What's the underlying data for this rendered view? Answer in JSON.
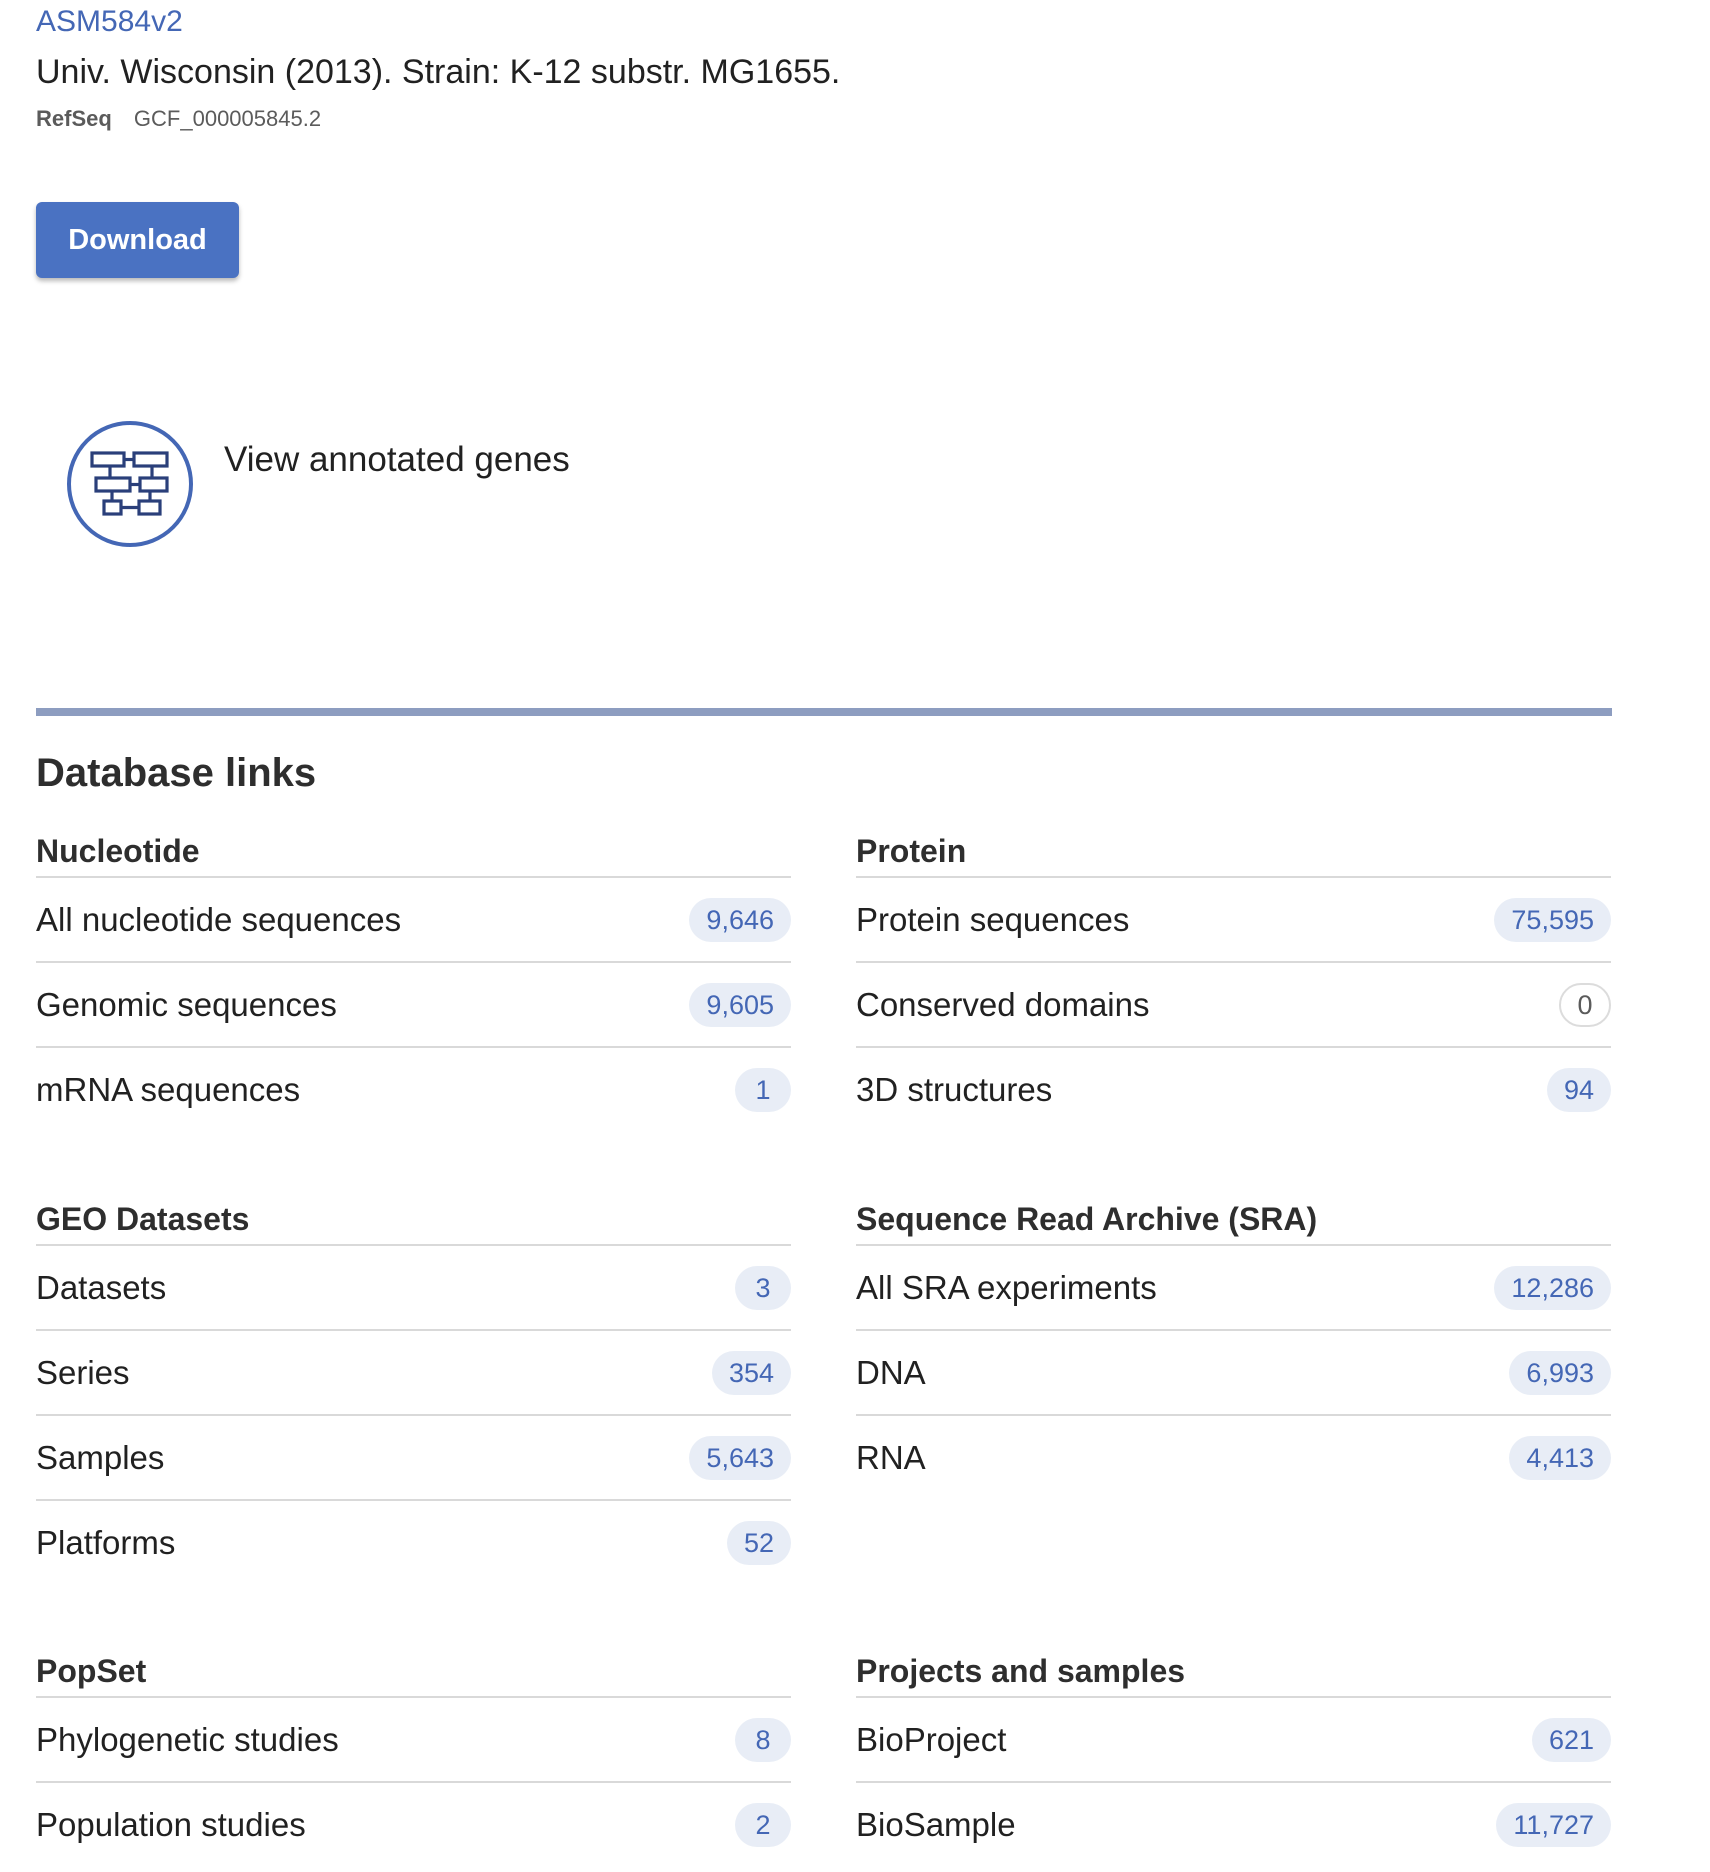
{
  "assembly": {
    "name": "ASM584v2",
    "description": "Univ. Wisconsin (2013). Strain: K-12 substr. MG1655.",
    "refseq_label": "RefSeq",
    "refseq_accession": "GCF_000005845.2"
  },
  "download_label": "Download",
  "genes_link": {
    "label": "View annotated genes",
    "icon": "gene-annotation-icon"
  },
  "database_links": {
    "heading": "Database links",
    "nucleotide": {
      "title": "Nucleotide",
      "rows": [
        {
          "label": "All nucleotide sequences",
          "count": "9,646"
        },
        {
          "label": "Genomic sequences",
          "count": "9,605"
        },
        {
          "label": "mRNA sequences",
          "count": "1"
        }
      ]
    },
    "protein": {
      "title": "Protein",
      "rows": [
        {
          "label": "Protein sequences",
          "count": "75,595"
        },
        {
          "label": "Conserved domains",
          "count": "0"
        },
        {
          "label": "3D structures",
          "count": "94"
        }
      ]
    },
    "geo": {
      "title": "GEO Datasets",
      "rows": [
        {
          "label": "Datasets",
          "count": "3"
        },
        {
          "label": "Series",
          "count": "354"
        },
        {
          "label": "Samples",
          "count": "5,643"
        },
        {
          "label": "Platforms",
          "count": "52"
        }
      ]
    },
    "sra": {
      "title": "Sequence Read Archive (SRA)",
      "rows": [
        {
          "label": "All SRA experiments",
          "count": "12,286"
        },
        {
          "label": "DNA",
          "count": "6,993"
        },
        {
          "label": "RNA",
          "count": "4,413"
        }
      ]
    },
    "popset": {
      "title": "PopSet",
      "rows": [
        {
          "label": "Phylogenetic studies",
          "count": "8"
        },
        {
          "label": "Population studies",
          "count": "2"
        }
      ]
    },
    "projects": {
      "title": "Projects and samples",
      "rows": [
        {
          "label": "BioProject",
          "count": "621"
        },
        {
          "label": "BioSample",
          "count": "11,727"
        }
      ]
    }
  },
  "colors": {
    "link_blue": "#4467b5",
    "button_blue": "#4a72c2",
    "badge_bg": "#e8edf6",
    "divider": "#8d9dc0"
  }
}
